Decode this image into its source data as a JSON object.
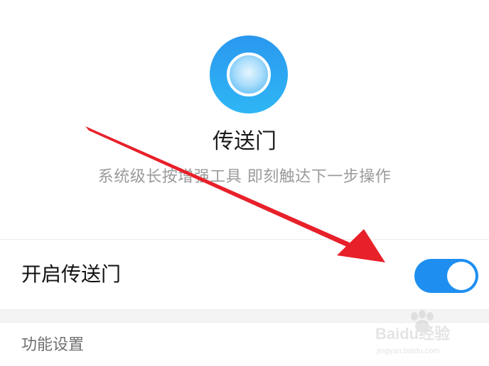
{
  "app": {
    "title": "传送门",
    "subtitle": "系统级长按增强工具 即刻触达下一步操作",
    "logo_icon": "circle-logo-icon"
  },
  "toggle_row": {
    "label": "开启传送门",
    "enabled": true
  },
  "section": {
    "header": "功能设置"
  },
  "watermark": {
    "brand": "Baidu经验",
    "url": "jingyan.baidu.com"
  },
  "colors": {
    "accent": "#1e8ff0",
    "arrow": "#e8202a",
    "title": "#1a1a1a",
    "subtitle": "#9a9a9a"
  }
}
